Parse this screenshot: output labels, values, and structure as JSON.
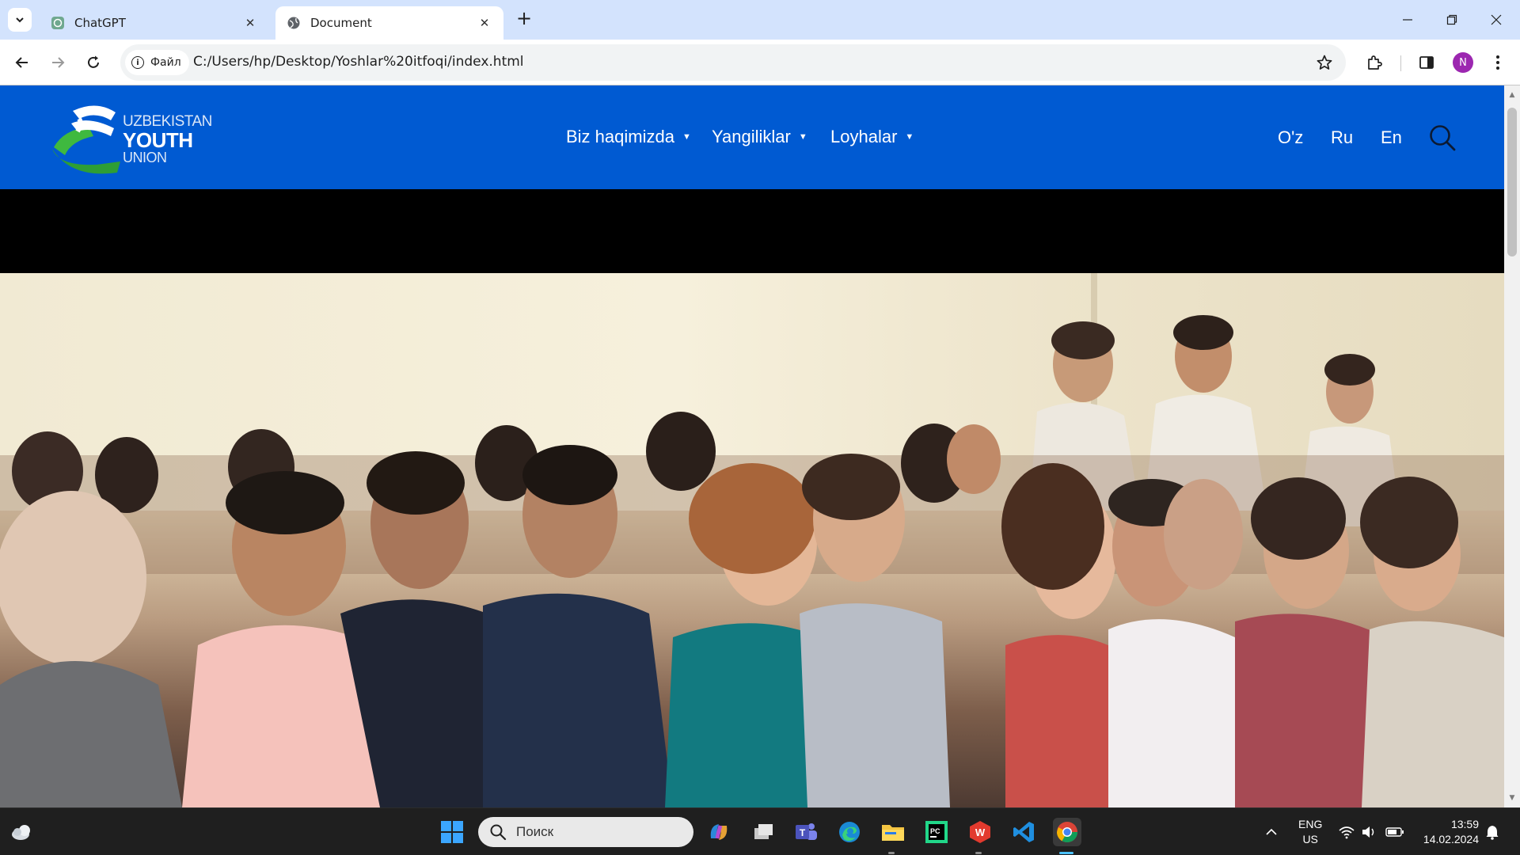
{
  "browser": {
    "tabs": [
      {
        "title": "ChatGPT",
        "favicon": "chatgpt-icon",
        "active": false
      },
      {
        "title": "Document",
        "favicon": "globe-icon",
        "active": true
      }
    ],
    "site_chip_label": "Файл",
    "url": "C:/Users/hp/Desktop/Yoshlar%20itfoqi/index.html",
    "profile_initial": "N"
  },
  "site": {
    "logo": {
      "line1": "UZBEKISTAN",
      "line2": "YOUTH",
      "line3": "UNION"
    },
    "nav": [
      {
        "label": "Biz haqimizda",
        "icon": "caret-down-icon"
      },
      {
        "label": "Yangiliklar",
        "icon": "caret-down-icon"
      },
      {
        "label": "Loyhalar",
        "icon": "caret-down-icon"
      }
    ],
    "languages": [
      "O'z",
      "Ru",
      "En"
    ],
    "header_color": "#005ad2"
  },
  "taskbar": {
    "search_placeholder": "Поиск",
    "input_lang_line1": "ENG",
    "input_lang_line2": "US",
    "time": "13:59",
    "date": "14.02.2024",
    "pinned_apps": [
      "windows-start-icon",
      "copilot-icon",
      "task-view-icon",
      "teams-icon",
      "edge-icon",
      "file-explorer-icon",
      "pycharm-icon",
      "wps-office-icon",
      "vscode-icon",
      "chrome-icon"
    ]
  }
}
